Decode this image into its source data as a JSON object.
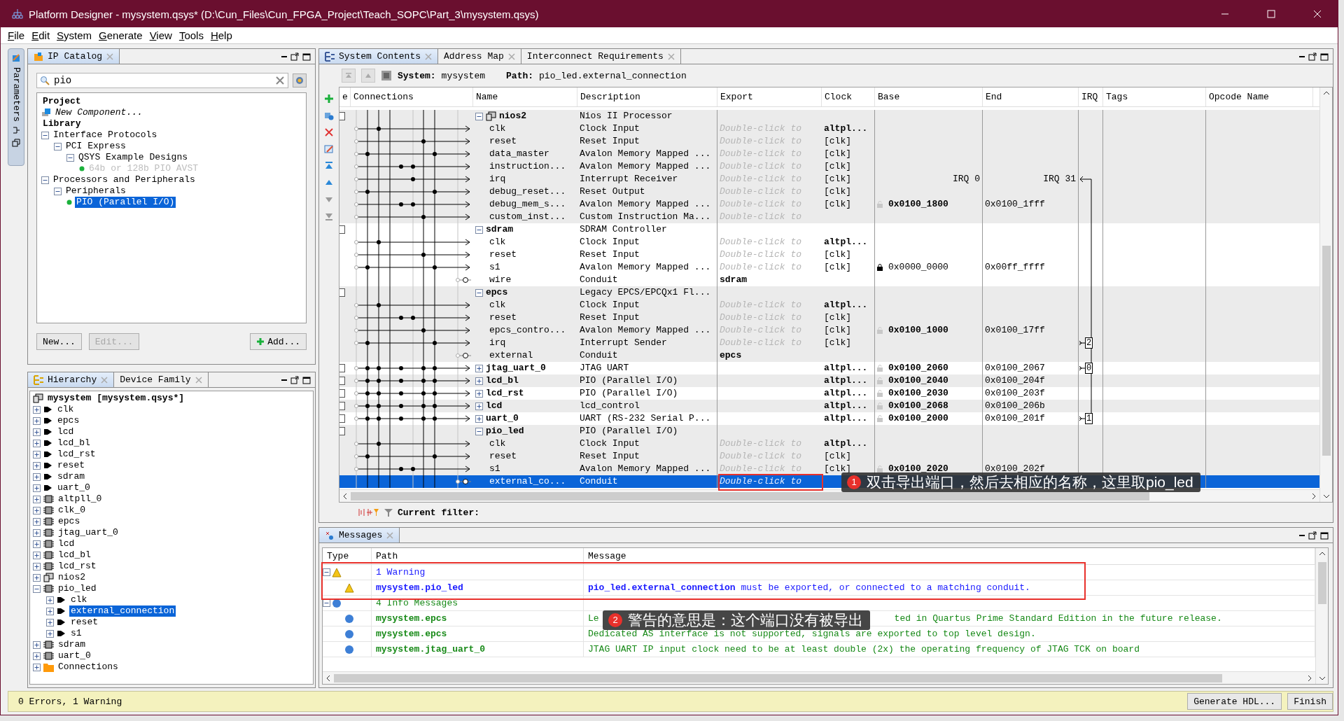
{
  "window": {
    "title": "Platform Designer - mysystem.qsys* (D:\\Cun_Files\\Cun_FPGA_Project\\Teach_SOPC\\Part_3\\mysystem.qsys)"
  },
  "menu": [
    "File",
    "Edit",
    "System",
    "Generate",
    "View",
    "Tools",
    "Help"
  ],
  "side_strip": {
    "label": "Parameters"
  },
  "ip_catalog": {
    "tab": {
      "label": "IP Catalog",
      "selected": true
    },
    "search": {
      "value": "pio"
    },
    "tree": [
      {
        "label": "Project",
        "kind": "heading",
        "children": [
          {
            "label": "New Component...",
            "kind": "new"
          }
        ]
      },
      {
        "label": "Library",
        "kind": "heading",
        "children": [
          {
            "label": "Interface Protocols",
            "kind": "folder",
            "expanded": true,
            "selected": false,
            "children": [
              {
                "label": "PCI Express",
                "kind": "folder",
                "expanded": true,
                "selected": false,
                "children": [
                  {
                    "label": "QSYS Example Designs",
                    "kind": "folder",
                    "expanded": true,
                    "selected": false,
                    "children": [
                      {
                        "label": "64b or 128b PIO AVST",
                        "kind": "item",
                        "disabled": true,
                        "selected": false
                      }
                    ]
                  }
                ]
              }
            ]
          },
          {
            "label": "Processors and Peripherals",
            "kind": "folder",
            "expanded": true,
            "selected": false,
            "children": [
              {
                "label": "Peripherals",
                "kind": "folder",
                "expanded": true,
                "selected": false,
                "children": [
                  {
                    "label": "PIO (Parallel I/O)",
                    "kind": "item",
                    "disabled": false,
                    "selected": true
                  }
                ]
              }
            ]
          }
        ]
      }
    ],
    "buttons": [
      {
        "label": "New...",
        "kind": "plain",
        "disabled": false
      },
      {
        "label": "Edit...",
        "kind": "plain",
        "disabled": true
      },
      {
        "label": "Add...",
        "kind": "add",
        "disabled": false
      }
    ]
  },
  "hierarchy": {
    "tabs": [
      {
        "label": "Hierarchy",
        "selected": true
      },
      {
        "label": "Device Family",
        "selected": false
      }
    ],
    "root": {
      "label": "mysystem [mysystem.qsys*]"
    },
    "items": [
      {
        "label": "clk",
        "kind": "interface",
        "expanded": false,
        "selected": false
      },
      {
        "label": "epcs",
        "kind": "interface",
        "expanded": false,
        "selected": false
      },
      {
        "label": "lcd",
        "kind": "interface",
        "expanded": false,
        "selected": false
      },
      {
        "label": "lcd_bl",
        "kind": "interface",
        "expanded": false,
        "selected": false
      },
      {
        "label": "lcd_rst",
        "kind": "interface",
        "expanded": false,
        "selected": false
      },
      {
        "label": "reset",
        "kind": "interface",
        "expanded": false,
        "selected": false
      },
      {
        "label": "sdram",
        "kind": "interface",
        "expanded": false,
        "selected": false
      },
      {
        "label": "uart_0",
        "kind": "interface",
        "expanded": false,
        "selected": false
      },
      {
        "label": "altpll_0",
        "kind": "module",
        "expanded": false,
        "selected": false
      },
      {
        "label": "clk_0",
        "kind": "module",
        "expanded": false,
        "selected": false
      },
      {
        "label": "epcs",
        "kind": "module",
        "expanded": false,
        "selected": false
      },
      {
        "label": "jtag_uart_0",
        "kind": "module",
        "expanded": false,
        "selected": false
      },
      {
        "label": "lcd",
        "kind": "module",
        "expanded": false,
        "selected": false
      },
      {
        "label": "lcd_bl",
        "kind": "module",
        "expanded": false,
        "selected": false
      },
      {
        "label": "lcd_rst",
        "kind": "module",
        "expanded": false,
        "selected": false
      },
      {
        "label": "nios2",
        "kind": "processor",
        "expanded": false,
        "selected": false
      },
      {
        "label": "pio_led",
        "kind": "module",
        "expanded": true,
        "selected": false,
        "children": [
          {
            "label": "clk",
            "kind": "interface",
            "expanded": false,
            "selected": false
          },
          {
            "label": "external_connection",
            "kind": "interface",
            "expanded": false,
            "selected": true
          },
          {
            "label": "reset",
            "kind": "interface",
            "expanded": false,
            "selected": false
          },
          {
            "label": "s1",
            "kind": "interface",
            "expanded": false,
            "selected": false
          }
        ]
      },
      {
        "label": "sdram",
        "kind": "module",
        "expanded": false,
        "selected": false
      },
      {
        "label": "uart_0",
        "kind": "module",
        "expanded": false,
        "selected": false
      },
      {
        "label": "Connections",
        "kind": "folder",
        "expanded": false,
        "selected": false
      }
    ]
  },
  "system_contents": {
    "tabs": [
      {
        "label": "System Contents",
        "selected": true
      },
      {
        "label": "Address Map",
        "selected": false
      },
      {
        "label": "Interconnect Requirements",
        "selected": false
      }
    ],
    "path_bar": {
      "system_label": "System:",
      "system": "mysystem",
      "path_label": "Path:",
      "path": "pio_led.external_connection"
    },
    "columns": [
      "e",
      "Connections",
      "Name",
      "Description",
      "Export",
      "Clock",
      "Base",
      "End",
      "IRQ",
      "Tags",
      "Opcode Name"
    ],
    "rows": [
      {
        "kind": "processor",
        "name": "nios2",
        "expanded": true,
        "description": "Nios II Processor",
        "selected": false
      },
      {
        "kind": "clock",
        "name": "clk",
        "description": "Clock Input",
        "export": "Double-click to",
        "exported": false,
        "clock": "altpl...",
        "selected": false
      },
      {
        "kind": "port",
        "name": "reset",
        "description": "Reset Input",
        "export": "Double-click to",
        "exported": false,
        "clock": "[clk]",
        "selected": false
      },
      {
        "kind": "port",
        "name": "data_master",
        "description": "Avalon Memory Mapped ...",
        "export": "Double-click to",
        "exported": false,
        "clock": "[clk]",
        "selected": false
      },
      {
        "kind": "port",
        "name": "instruction...",
        "description": "Avalon Memory Mapped ...",
        "export": "Double-click to",
        "exported": false,
        "clock": "[clk]",
        "selected": false
      },
      {
        "kind": "interrupt",
        "name": "irq",
        "description": "Interrupt Receiver",
        "export": "Double-click to",
        "exported": false,
        "clock": "[clk]",
        "base": "IRQ 0",
        "end": "IRQ 31",
        "selected": false
      },
      {
        "kind": "port",
        "name": "debug_reset...",
        "description": "Reset Output",
        "export": "Double-click to",
        "exported": false,
        "clock": "[clk]",
        "selected": false
      },
      {
        "kind": "port",
        "name": "debug_mem_s...",
        "description": "Avalon Memory Mapped ...",
        "export": "Double-click to",
        "exported": false,
        "clock": "[clk]",
        "base": "0x0100_1800",
        "locked": false,
        "end": "0x0100_1fff",
        "selected": false
      },
      {
        "kind": "port",
        "name": "custom_inst...",
        "description": "Custom Instruction Ma...",
        "export": "Double-click to",
        "exported": false,
        "selected": false
      },
      {
        "kind": "module",
        "name": "sdram",
        "expanded": true,
        "description": "SDRAM Controller",
        "selected": false
      },
      {
        "kind": "clock",
        "name": "clk",
        "description": "Clock Input",
        "export": "Double-click to",
        "exported": false,
        "clock": "altpl...",
        "selected": false
      },
      {
        "kind": "port",
        "name": "reset",
        "description": "Reset Input",
        "export": "Double-click to",
        "exported": false,
        "clock": "[clk]",
        "selected": false
      },
      {
        "kind": "port",
        "name": "s1",
        "description": "Avalon Memory Mapped ...",
        "export": "Double-click to",
        "exported": false,
        "clock": "[clk]",
        "base": "0x0000_0000",
        "locked": true,
        "end": "0x00ff_ffff",
        "selected": false
      },
      {
        "kind": "conduit",
        "name": "wire",
        "description": "Conduit",
        "export": "sdram",
        "exported": true,
        "selected": false
      },
      {
        "kind": "module",
        "name": "epcs",
        "expanded": true,
        "description": "Legacy EPCS/EPCQx1 Fl...",
        "selected": false
      },
      {
        "kind": "clock",
        "name": "clk",
        "description": "Clock Input",
        "export": "Double-click to",
        "exported": false,
        "clock": "altpl...",
        "selected": false
      },
      {
        "kind": "port",
        "name": "reset",
        "description": "Reset Input",
        "export": "Double-click to",
        "exported": false,
        "clock": "[clk]",
        "selected": false
      },
      {
        "kind": "port",
        "name": "epcs_contro...",
        "description": "Avalon Memory Mapped ...",
        "export": "Double-click to",
        "exported": false,
        "clock": "[clk]",
        "base": "0x0100_1000",
        "locked": false,
        "end": "0x0100_17ff",
        "selected": false
      },
      {
        "kind": "port",
        "name": "irq",
        "description": "Interrupt Sender",
        "export": "Double-click to",
        "exported": false,
        "clock": "[clk]",
        "irq": "2",
        "selected": false
      },
      {
        "kind": "conduit",
        "name": "external",
        "description": "Conduit",
        "export": "epcs",
        "exported": true,
        "selected": false
      },
      {
        "kind": "module",
        "name": "jtag_uart_0",
        "expanded": false,
        "description": "JTAG UART",
        "clock": "altpl...",
        "base": "0x0100_2060",
        "locked": false,
        "end": "0x0100_2067",
        "irq": "0",
        "selected": false
      },
      {
        "kind": "module",
        "name": "lcd_bl",
        "expanded": false,
        "description": "PIO (Parallel I/O)",
        "clock": "altpl...",
        "base": "0x0100_2040",
        "locked": false,
        "end": "0x0100_204f",
        "selected": false
      },
      {
        "kind": "module",
        "name": "lcd_rst",
        "expanded": false,
        "description": "PIO (Parallel I/O)",
        "clock": "altpl...",
        "base": "0x0100_2030",
        "locked": false,
        "end": "0x0100_203f",
        "selected": false
      },
      {
        "kind": "module",
        "name": "lcd",
        "expanded": false,
        "description": "lcd_control",
        "clock": "altpl...",
        "base": "0x0100_2068",
        "locked": false,
        "end": "0x0100_206b",
        "selected": false
      },
      {
        "kind": "module",
        "name": "uart_0",
        "expanded": false,
        "description": "UART (RS-232 Serial P...",
        "clock": "altpl...",
        "base": "0x0100_2000",
        "locked": false,
        "end": "0x0100_201f",
        "irq": "1",
        "selected": false
      },
      {
        "kind": "module",
        "name": "pio_led",
        "expanded": true,
        "description": "PIO (Parallel I/O)",
        "selected": false
      },
      {
        "kind": "clock",
        "name": "clk",
        "description": "Clock Input",
        "export": "Double-click to",
        "exported": false,
        "clock": "altpl...",
        "selected": false
      },
      {
        "kind": "port",
        "name": "reset",
        "description": "Reset Input",
        "export": "Double-click to",
        "exported": false,
        "clock": "[clk]",
        "selected": false
      },
      {
        "kind": "port",
        "name": "s1",
        "description": "Avalon Memory Mapped ...",
        "export": "Double-click to",
        "exported": false,
        "clock": "[clk]",
        "base": "0x0100_2020",
        "locked": false,
        "end": "0x0100_202f",
        "selected": false
      },
      {
        "kind": "conduit",
        "name": "external_co...",
        "description": "Conduit",
        "export": "Double-click to",
        "exported": false,
        "highlighted": true,
        "selected": true
      }
    ],
    "filter": {
      "label": "Current filter:"
    },
    "annotation": {
      "number": "1",
      "text": "双击导出端口，然后去相应的名称，这里取pio_led"
    }
  },
  "messages": {
    "tab": {
      "label": "Messages",
      "selected": true
    },
    "columns": [
      "Type",
      "Path",
      "Message"
    ],
    "rows": [
      {
        "kind": "warning_group",
        "expanded": true,
        "text": "1 Warning"
      },
      {
        "kind": "warning",
        "path": "mysystem.pio_led",
        "message": "**pio_led.external_connection** must be exported, or connected to a matching conduit."
      },
      {
        "kind": "info_group",
        "expanded": true,
        "text": "4 Info Messages"
      },
      {
        "kind": "info",
        "path": "mysystem.epcs",
        "message": "Le",
        "message_rest": "ted in Quartus Prime Standard Edition in the future release."
      },
      {
        "kind": "info",
        "path": "mysystem.epcs",
        "message": "Dedicated AS interface is not supported, signals are exported to top level design."
      },
      {
        "kind": "info",
        "path": "mysystem.jtag_uart_0",
        "message": "JTAG UART IP input clock need to be at least double (2x) the operating frequency of JTAG TCK on board"
      }
    ],
    "annotation": {
      "number": "2",
      "text": "警告的意思是：这个端口没有被导出"
    }
  },
  "status_bar": {
    "text": "0 Errors, 1 Warning",
    "buttons": [
      "Generate HDL...",
      "Finish"
    ]
  }
}
